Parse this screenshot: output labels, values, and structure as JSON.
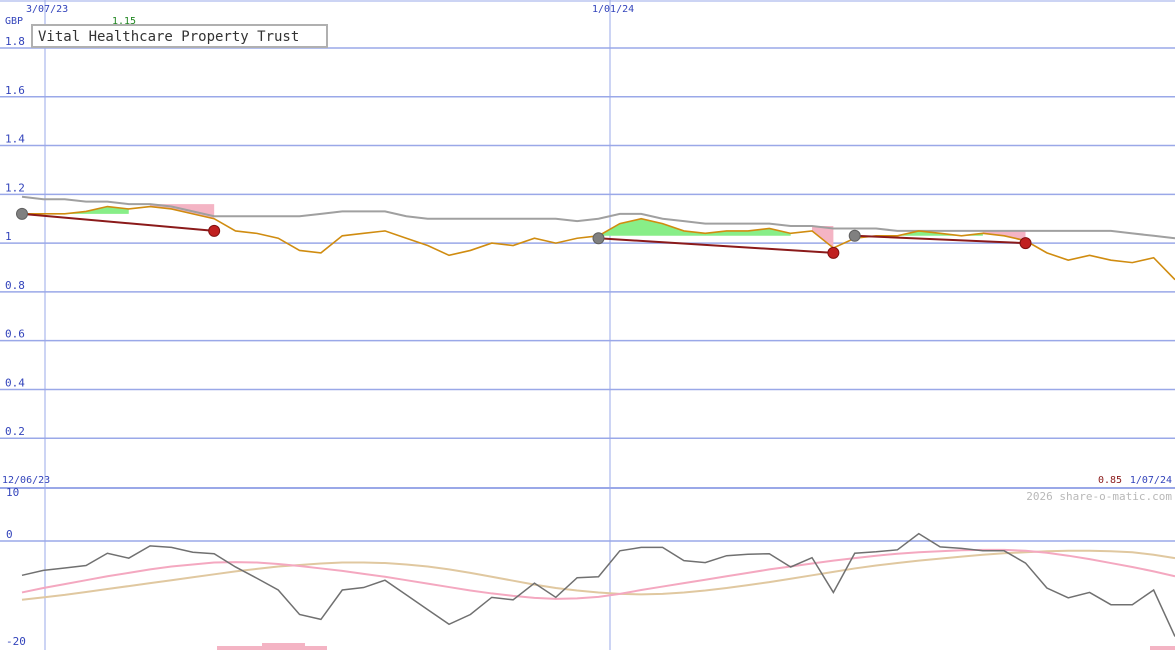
{
  "title": "Vital Healthcare Property Trust",
  "currency_label": "GBP",
  "top_left_date": "3/07/23",
  "top_mid_date": "1/01/24",
  "bottom_left_date": "12/06/23",
  "bottom_right_date": "1/07/24",
  "max_price_label": "1.15",
  "min_price_label": "0.85",
  "watermark": "2026 share-o-matic.com",
  "colors": {
    "grid": "#9aa8e8",
    "price": "#d08c10",
    "ma": "#a0a0a0",
    "trend": "#8b1a1a",
    "up_fill": "#88ee88",
    "down_fill": "#f4b4c4",
    "osc_main": "#707070",
    "osc_pink": "#f4a8c0",
    "osc_tan": "#e0c8a0",
    "axis_text": "#3344bb"
  },
  "chart_data": [
    {
      "type": "line",
      "panel": "price",
      "title": "Vital Healthcare Property Trust",
      "ylabel": "GBP",
      "ylim": [
        0,
        1.8
      ],
      "yticks": [
        0.2,
        0.4,
        0.6,
        0.8,
        1,
        1.2,
        1.4,
        1.6,
        1.8
      ],
      "ytick_labels": [
        "0.2",
        "0.4",
        "0.6",
        "0.8",
        "1",
        "1.2",
        "1.4",
        "1.6",
        "1.8"
      ],
      "x_date_labels": [
        "3/07/23",
        "1/01/24"
      ],
      "x": [
        0,
        1,
        2,
        3,
        4,
        5,
        6,
        7,
        8,
        9,
        10,
        11,
        12,
        13,
        14,
        15,
        16,
        17,
        18,
        19,
        20,
        21,
        22,
        23,
        24,
        25,
        26,
        27,
        28,
        29,
        30,
        31,
        32,
        33,
        34,
        35,
        36,
        37,
        38,
        39,
        40,
        41,
        42,
        43,
        44,
        45,
        46,
        47,
        48,
        49,
        50,
        51,
        52,
        53,
        54
      ],
      "series": [
        {
          "values": [
            1.12,
            1.12,
            1.12,
            1.13,
            1.15,
            1.14,
            1.15,
            1.14,
            1.12,
            1.1,
            1.05,
            1.04,
            1.02,
            0.97,
            0.96,
            1.03,
            1.04,
            1.05,
            1.02,
            0.99,
            0.95,
            0.97,
            1.0,
            0.99,
            1.02,
            1.0,
            1.02,
            1.03,
            1.08,
            1.1,
            1.08,
            1.05,
            1.04,
            1.05,
            1.05,
            1.06,
            1.04,
            1.05,
            0.98,
            1.02,
            1.03,
            1.03,
            1.05,
            1.04,
            1.03,
            1.04,
            1.03,
            1.01,
            0.96,
            0.93,
            0.95,
            0.93,
            0.92,
            0.94,
            0.85
          ]
        },
        {
          "values": [
            1.19,
            1.18,
            1.18,
            1.17,
            1.17,
            1.16,
            1.16,
            1.15,
            1.13,
            1.11,
            1.11,
            1.11,
            1.11,
            1.11,
            1.12,
            1.13,
            1.13,
            1.13,
            1.11,
            1.1,
            1.1,
            1.1,
            1.1,
            1.1,
            1.1,
            1.1,
            1.09,
            1.1,
            1.12,
            1.12,
            1.1,
            1.09,
            1.08,
            1.08,
            1.08,
            1.08,
            1.07,
            1.07,
            1.06,
            1.06,
            1.06,
            1.05,
            1.05,
            1.05,
            1.05,
            1.05,
            1.05,
            1.05,
            1.05,
            1.05,
            1.05,
            1.05,
            1.04,
            1.03,
            1.02
          ]
        }
      ],
      "trend_segments": [
        {
          "from": [
            0,
            1.12
          ],
          "to": [
            9,
            1.05
          ]
        },
        {
          "from": [
            27,
            1.02
          ],
          "to": [
            38,
            0.96
          ]
        },
        {
          "from": [
            39,
            1.03
          ],
          "to": [
            47,
            1.0
          ]
        }
      ],
      "markers": [
        {
          "x": 0,
          "y": 1.12,
          "kind": "peak"
        },
        {
          "x": 9,
          "y": 1.05,
          "kind": "trough"
        },
        {
          "x": 27,
          "y": 1.02,
          "kind": "peak"
        },
        {
          "x": 38,
          "y": 0.96,
          "kind": "trough"
        },
        {
          "x": 39,
          "y": 1.03,
          "kind": "peak"
        },
        {
          "x": 47,
          "y": 1.0,
          "kind": "trough"
        }
      ]
    },
    {
      "type": "line",
      "panel": "oscillator",
      "ylim": [
        -20,
        10
      ],
      "yticks": [
        10,
        0,
        -20
      ],
      "ytick_labels": [
        "10",
        "0",
        "-20"
      ],
      "x_date_labels": [
        "12/06/23",
        "1/07/24"
      ],
      "series": [
        {
          "values": [
            -7,
            -6,
            -5.5,
            -5,
            -2.5,
            -3.5,
            -1,
            -1.3,
            -2.3,
            -2.6,
            -5.3,
            -7.6,
            -10,
            -15,
            -16,
            -10,
            -9.5,
            -8,
            -11,
            -14,
            -17,
            -15,
            -11.5,
            -12,
            -8.6,
            -11.5,
            -7.5,
            -7.3,
            -2,
            -1.3,
            -1.3,
            -4,
            -4.4,
            -3,
            -2.7,
            -2.6,
            -5.3,
            -3.4,
            -10.5,
            -2.5,
            -2.2,
            -1.8,
            1.5,
            -1.2,
            -1.5,
            -2,
            -2,
            -4.5,
            -9.6,
            -11.6,
            -10.5,
            -13,
            -13,
            -10,
            -19.5
          ]
        },
        {
          "values": [
            -10.5,
            -9.6,
            -8.8,
            -8,
            -7.2,
            -6.5,
            -5.8,
            -5.2,
            -4.8,
            -4.4,
            -4.3,
            -4.4,
            -4.7,
            -5.1,
            -5.6,
            -6.1,
            -6.7,
            -7.3,
            -8,
            -8.7,
            -9.4,
            -10.1,
            -10.7,
            -11.2,
            -11.6,
            -11.8,
            -11.7,
            -11.4,
            -10.8,
            -10,
            -9.3,
            -8.6,
            -7.9,
            -7.2,
            -6.5,
            -5.8,
            -5.2,
            -4.6,
            -4,
            -3.5,
            -3,
            -2.6,
            -2.3,
            -2.1,
            -1.9,
            -1.8,
            -1.8,
            -2,
            -2.4,
            -3,
            -3.7,
            -4.5,
            -5.3,
            -6.2,
            -7.2
          ]
        },
        {
          "values": [
            -12,
            -11.5,
            -11,
            -10.4,
            -9.8,
            -9.2,
            -8.6,
            -8,
            -7.4,
            -6.8,
            -6.2,
            -5.7,
            -5.2,
            -4.9,
            -4.6,
            -4.4,
            -4.4,
            -4.5,
            -4.8,
            -5.2,
            -5.8,
            -6.5,
            -7.3,
            -8.1,
            -8.9,
            -9.6,
            -10.1,
            -10.5,
            -10.8,
            -10.9,
            -10.8,
            -10.5,
            -10.1,
            -9.6,
            -9,
            -8.4,
            -7.7,
            -7,
            -6.3,
            -5.6,
            -5,
            -4.5,
            -4,
            -3.6,
            -3.2,
            -2.8,
            -2.5,
            -2.3,
            -2.1,
            -2,
            -2,
            -2.1,
            -2.3,
            -2.8,
            -3.5
          ]
        }
      ]
    }
  ]
}
